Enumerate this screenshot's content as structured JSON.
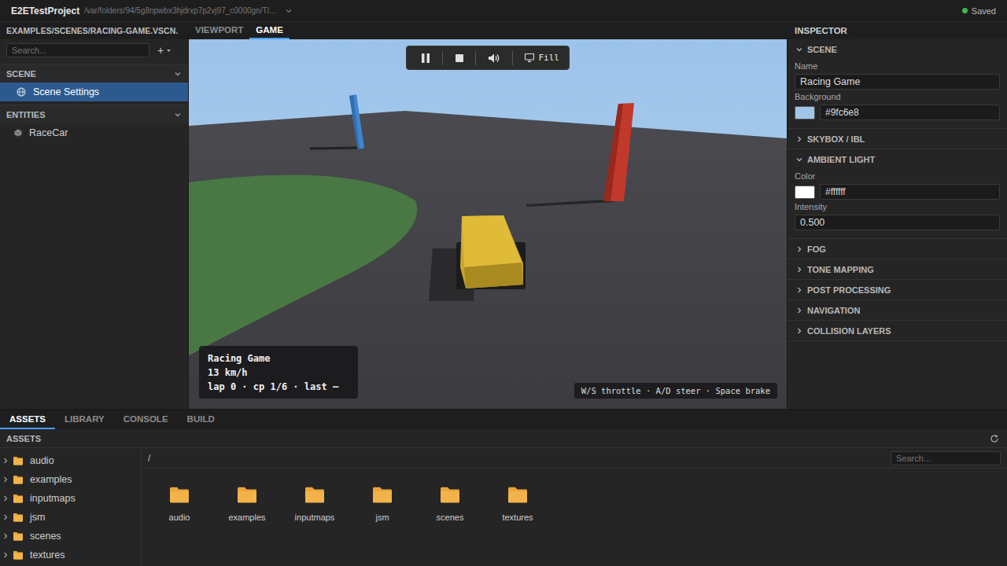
{
  "window": {
    "title": "E2ETestProject",
    "path": "/var/folders/94/5g8npwbx3hjdrxp7p2vj97_c0000gn/T/...",
    "status": "Saved"
  },
  "editor_tab": {
    "label": "EXAMPLES/SCENES/RACING-GAME.VSCN."
  },
  "view_tabs": [
    {
      "label": "VIEWPORT",
      "selected": false
    },
    {
      "label": "GAME",
      "selected": true
    }
  ],
  "hierarchy": {
    "search": {
      "placeholder": "Search..."
    },
    "add_button": "+",
    "sections": [
      {
        "title": "SCENE",
        "expanded": true,
        "items": [
          {
            "label": "Scene Settings",
            "kind": "scene",
            "selected": true
          }
        ]
      },
      {
        "title": "ENTITIES",
        "expanded": true,
        "items": [
          {
            "label": "RaceCar",
            "kind": "entity",
            "selected": false
          }
        ]
      }
    ]
  },
  "game": {
    "toolbar": {
      "playing": true,
      "muted": false,
      "scale_mode": "Fill"
    },
    "hud": {
      "title": "Racing Game",
      "speed": "13 km/h",
      "status": "lap 0 · cp 1/6 · last —"
    },
    "hint": "W/S throttle · A/D steer · Space brake"
  },
  "inspector": {
    "title": "INSPECTOR",
    "sections": [
      {
        "title": "SCENE",
        "expanded": true,
        "fields": [
          {
            "label": "Name",
            "kind": "text",
            "value": "Racing Game"
          },
          {
            "label": "Background",
            "kind": "color",
            "value": "#9fc6e8"
          }
        ]
      },
      {
        "title": "SKYBOX / IBL",
        "expanded": false,
        "fields": []
      },
      {
        "title": "AMBIENT LIGHT",
        "expanded": true,
        "fields": [
          {
            "label": "Color",
            "kind": "color",
            "value": "#ffffff"
          },
          {
            "label": "Intensity",
            "kind": "text",
            "value": "0.500"
          }
        ]
      },
      {
        "title": "FOG",
        "expanded": false,
        "fields": []
      },
      {
        "title": "TONE MAPPING",
        "expanded": false,
        "fields": []
      },
      {
        "title": "POST PROCESSING",
        "expanded": false,
        "fields": []
      },
      {
        "title": "NAVIGATION",
        "expanded": false,
        "fields": []
      },
      {
        "title": "COLLISION LAYERS",
        "expanded": false,
        "fields": []
      }
    ]
  },
  "bottom_tabs": [
    {
      "label": "ASSETS",
      "selected": true
    },
    {
      "label": "LIBRARY",
      "selected": false
    },
    {
      "label": "CONSOLE",
      "selected": false
    },
    {
      "label": "BUILD",
      "selected": false
    }
  ],
  "assets": {
    "title": "ASSETS",
    "tree": [
      {
        "label": "audio",
        "expanded": false
      },
      {
        "label": "examples",
        "expanded": false
      },
      {
        "label": "inputmaps",
        "expanded": false
      },
      {
        "label": "jsm",
        "expanded": false
      },
      {
        "label": "scenes",
        "expanded": false
      },
      {
        "label": "textures",
        "expanded": false
      }
    ],
    "path": "/",
    "search": {
      "placeholder": "Search..."
    },
    "folders": [
      "audio",
      "examples",
      "inputmaps",
      "jsm",
      "scenes",
      "textures"
    ]
  }
}
